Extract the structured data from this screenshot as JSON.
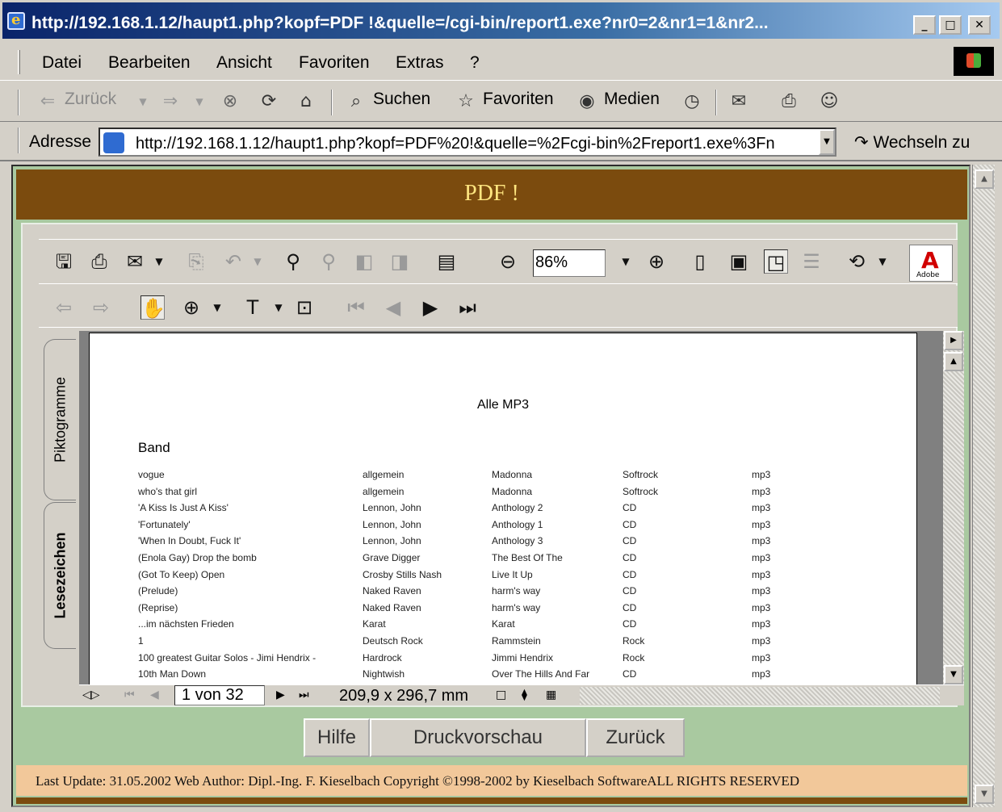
{
  "window": {
    "title": "http://192.168.1.12/haupt1.php?kopf=PDF !&quelle=/cgi-bin/report1.exe?nr0=2&nr1=1&nr2..."
  },
  "menu": [
    "Datei",
    "Bearbeiten",
    "Ansicht",
    "Favoriten",
    "Extras",
    "?"
  ],
  "toolbar": {
    "back": "Zurück",
    "search": "Suchen",
    "favorites": "Favoriten",
    "media": "Medien"
  },
  "address": {
    "label": "Adresse",
    "url": "http://192.168.1.12/haupt1.php?kopf=PDF%20!&quelle=%2Fcgi-bin%2Freport1.exe%3Fn",
    "go": "Wechseln zu"
  },
  "page": {
    "header": "PDF !",
    "footer": "Last Update: 31.05.2002 Web Author: Dipl.-Ing. F. Kieselbach Copyright ©1998-2002 by Kieselbach SoftwareALL RIGHTS RESERVED",
    "buttons": [
      "Hilfe",
      "Druckvorschau",
      "Zurück"
    ]
  },
  "pdf_viewer": {
    "zoom": "86%",
    "tabs": [
      "Piktogramme",
      "Lesezeichen"
    ],
    "page_indicator": "1 von 32",
    "page_size": "209,9 x 296,7 mm",
    "document": {
      "title": "Alle MP3",
      "section": "Band",
      "rows": [
        [
          "vogue",
          "allgemein",
          "Madonna",
          "Softrock",
          "mp3"
        ],
        [
          "who's that girl",
          "allgemein",
          "Madonna",
          "Softrock",
          "mp3"
        ],
        [
          "'A Kiss Is Just A Kiss'",
          "Lennon, John",
          "Anthology 2",
          "CD",
          "mp3"
        ],
        [
          "'Fortunately'",
          "Lennon, John",
          "Anthology 1",
          "CD",
          "mp3"
        ],
        [
          "'When In Doubt, Fuck It'",
          "Lennon, John",
          "Anthology 3",
          "CD",
          "mp3"
        ],
        [
          "(Enola Gay) Drop the bomb",
          "Grave Digger",
          "The Best Of The",
          "CD",
          "mp3"
        ],
        [
          "(Got To Keep) Open",
          "Crosby Stills Nash",
          "Live It Up",
          "CD",
          "mp3"
        ],
        [
          "(Prelude)",
          "Naked Raven",
          "harm's way",
          "CD",
          "mp3"
        ],
        [
          "(Reprise)",
          "Naked Raven",
          "harm's way",
          "CD",
          "mp3"
        ],
        [
          "...im nächsten Frieden",
          "Karat",
          "Karat",
          "CD",
          "mp3"
        ],
        [
          "1",
          "Deutsch Rock",
          "Rammstein",
          "Rock",
          "mp3"
        ],
        [
          "100 greatest Guitar Solos - Jimi Hendrix -",
          "Hardrock",
          "Jimmi Hendrix",
          "Rock",
          "mp3"
        ],
        [
          "10th Man Down",
          "Nightwish",
          "Over The Hills And Far",
          "CD",
          "mp3"
        ]
      ]
    }
  }
}
